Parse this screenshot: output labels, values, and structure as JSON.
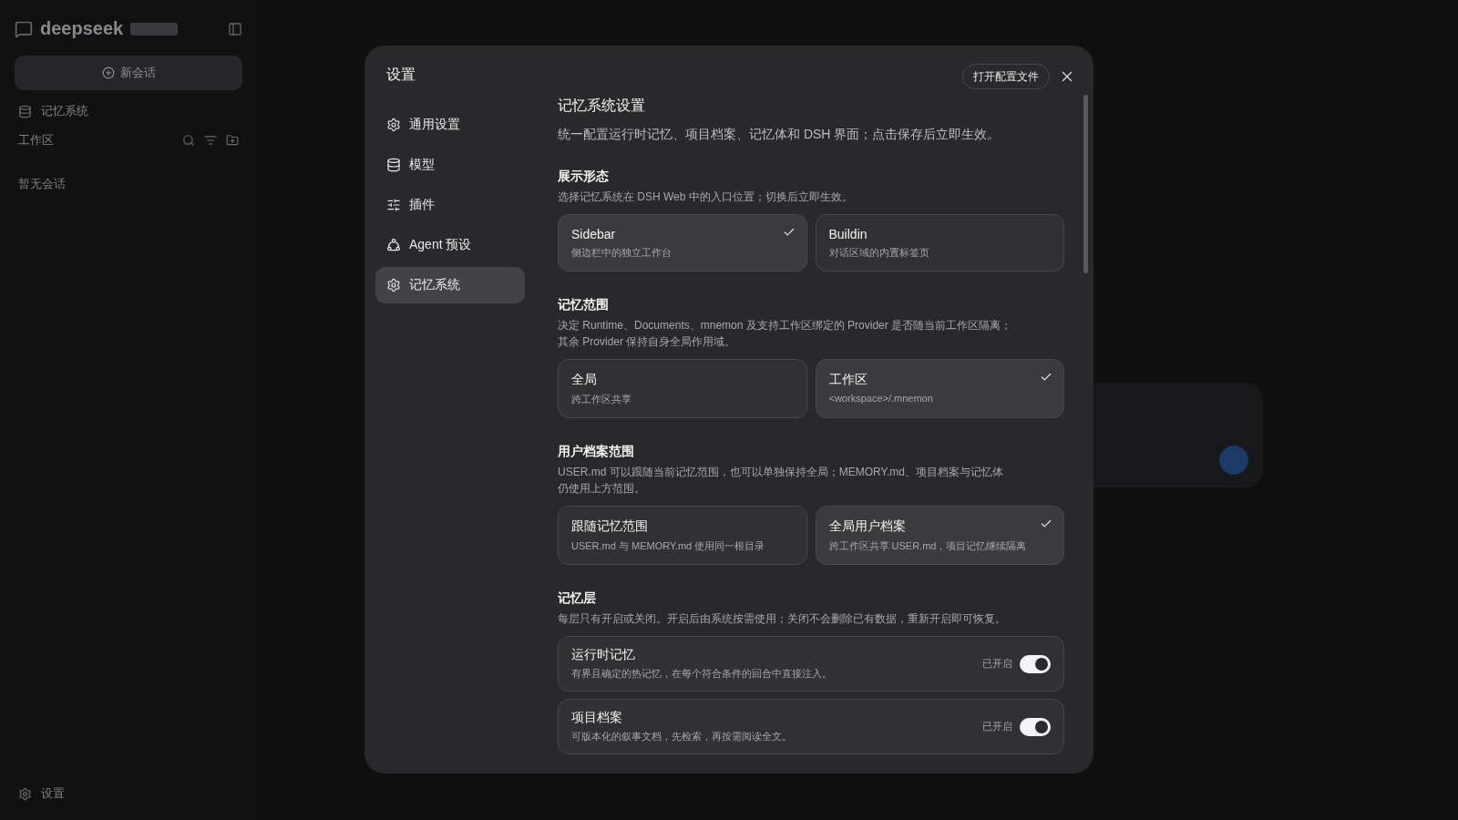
{
  "background": {
    "brand": "deepseek",
    "new_chat_button": "新会话",
    "memory_link": "记忆系统",
    "workspace_label": "工作区",
    "empty_text": "暂无会话",
    "settings_link": "设置"
  },
  "dialog": {
    "title": "设置",
    "open_config_button": "打开配置文件",
    "nav": [
      {
        "label": "通用设置",
        "selected": false
      },
      {
        "label": "模型",
        "selected": false
      },
      {
        "label": "插件",
        "selected": false
      },
      {
        "label": "Agent 预设",
        "selected": false
      },
      {
        "label": "记忆系统",
        "selected": true
      }
    ],
    "heading": "记忆系统设置",
    "description": "统一配置运行时记忆、项目档案、记忆体和 DSH 界面；点击保存后立即生效。",
    "sections": [
      {
        "kind": "choice",
        "title": "展示形态",
        "description": "选择记忆系统在 DSH Web 中的入口位置；切换后立即生效。",
        "options": [
          {
            "title": "Sidebar",
            "subtitle": "侧边栏中的独立工作台",
            "selected": true
          },
          {
            "title": "Buildin",
            "subtitle": "对话区域的内置标签页",
            "selected": false
          }
        ]
      },
      {
        "kind": "choice",
        "title": "记忆范围",
        "description": "决定 Runtime、Documents、mnemon 及支持工作区绑定的 Provider 是否随当前工作区隔离；其余 Provider 保持自身全局作用域。",
        "options": [
          {
            "title": "全局",
            "subtitle": "跨工作区共享",
            "selected": false
          },
          {
            "title": "工作区",
            "subtitle": "<workspace>/.mnemon",
            "selected": true
          }
        ]
      },
      {
        "kind": "choice",
        "title": "用户档案范围",
        "description": "USER.md 可以跟随当前记忆范围，也可以单独保持全局；MEMORY.md、项目档案与记忆体仍使用上方范围。",
        "options": [
          {
            "title": "跟随记忆范围",
            "subtitle": "USER.md 与 MEMORY.md 使用同一根目录",
            "selected": false
          },
          {
            "title": "全局用户档案",
            "subtitle": "跨工作区共享 USER.md，项目记忆继续隔离",
            "selected": true
          }
        ]
      },
      {
        "kind": "toggles",
        "title": "记忆层",
        "description": "每层只有开启或关闭。开启后由系统按需使用；关闭不会删除已有数据，重新开启即可恢复。",
        "items": [
          {
            "title": "运行时记忆",
            "subtitle": "有界且确定的热记忆，在每个符合条件的回合中直接注入。",
            "status": "已开启",
            "on": true
          },
          {
            "title": "项目档案",
            "subtitle": "可版本化的叙事文档，先检索，再按需阅读全文。",
            "status": "已开启",
            "on": true
          }
        ]
      }
    ]
  }
}
